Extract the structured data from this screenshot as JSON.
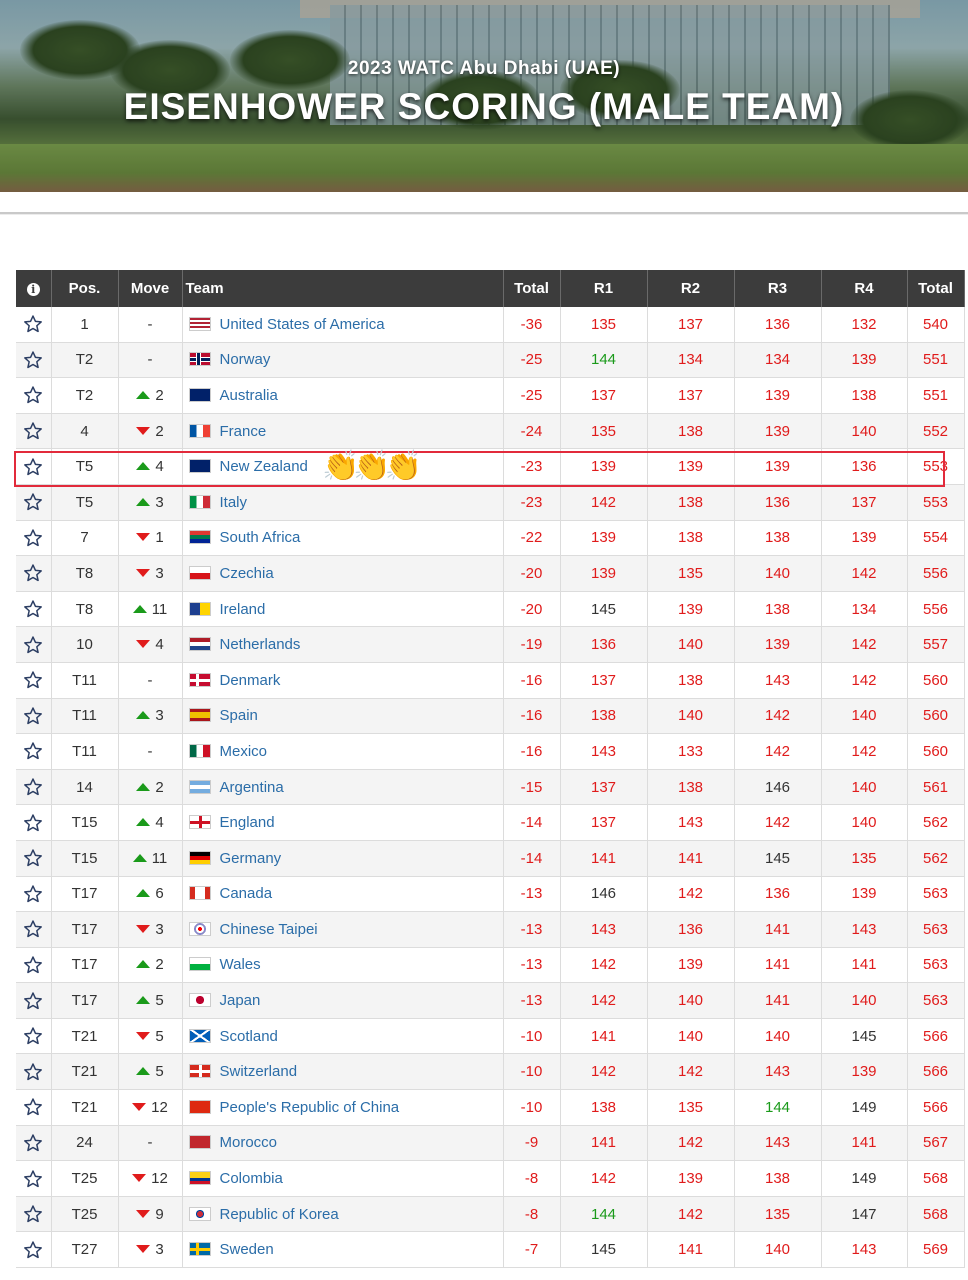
{
  "hero": {
    "subtitle": "2023 WATC Abu Dhabi (UAE)",
    "title": "EISENHOWER SCORING (MALE TEAM)"
  },
  "columns": [
    "Pos.",
    "Move",
    "Team",
    "Total",
    "R1",
    "R2",
    "R3",
    "R4",
    "Total"
  ],
  "colors": {
    "red": "#e01b1b",
    "green": "#1a9a1a",
    "link": "#2b6da8",
    "header": "#3c3c3c",
    "highlight": "#e22a3b"
  },
  "highlight_emoji": "👏👏👏",
  "rows": [
    {
      "pos": "1",
      "dir": "",
      "move": "-",
      "team": "United States of America",
      "flag": "us",
      "total": "-36",
      "r": [
        [
          "135",
          "red"
        ],
        [
          "137",
          "red"
        ],
        [
          "136",
          "red"
        ],
        [
          "132",
          "red"
        ]
      ],
      "sum": "540"
    },
    {
      "pos": "T2",
      "dir": "",
      "move": "-",
      "team": "Norway",
      "flag": "no",
      "total": "-25",
      "r": [
        [
          "144",
          "green"
        ],
        [
          "134",
          "red"
        ],
        [
          "134",
          "red"
        ],
        [
          "139",
          "red"
        ]
      ],
      "sum": "551"
    },
    {
      "pos": "T2",
      "dir": "up",
      "move": "2",
      "team": "Australia",
      "flag": "au",
      "total": "-25",
      "r": [
        [
          "137",
          "red"
        ],
        [
          "137",
          "red"
        ],
        [
          "139",
          "red"
        ],
        [
          "138",
          "red"
        ]
      ],
      "sum": "551"
    },
    {
      "pos": "4",
      "dir": "down",
      "move": "2",
      "team": "France",
      "flag": "fr",
      "total": "-24",
      "r": [
        [
          "135",
          "red"
        ],
        [
          "138",
          "red"
        ],
        [
          "139",
          "red"
        ],
        [
          "140",
          "red"
        ]
      ],
      "sum": "552"
    },
    {
      "pos": "T5",
      "dir": "up",
      "move": "4",
      "team": "New Zealand",
      "flag": "nz",
      "total": "-23",
      "r": [
        [
          "139",
          "red"
        ],
        [
          "139",
          "red"
        ],
        [
          "139",
          "red"
        ],
        [
          "136",
          "red"
        ]
      ],
      "sum": "553"
    },
    {
      "pos": "T5",
      "dir": "up",
      "move": "3",
      "team": "Italy",
      "flag": "it",
      "total": "-23",
      "r": [
        [
          "142",
          "red"
        ],
        [
          "138",
          "red"
        ],
        [
          "136",
          "red"
        ],
        [
          "137",
          "red"
        ]
      ],
      "sum": "553"
    },
    {
      "pos": "7",
      "dir": "down",
      "move": "1",
      "team": "South Africa",
      "flag": "za",
      "total": "-22",
      "r": [
        [
          "139",
          "red"
        ],
        [
          "138",
          "red"
        ],
        [
          "138",
          "red"
        ],
        [
          "139",
          "red"
        ]
      ],
      "sum": "554"
    },
    {
      "pos": "T8",
      "dir": "down",
      "move": "3",
      "team": "Czechia",
      "flag": "cz",
      "total": "-20",
      "r": [
        [
          "139",
          "red"
        ],
        [
          "135",
          "red"
        ],
        [
          "140",
          "red"
        ],
        [
          "142",
          "red"
        ]
      ],
      "sum": "556"
    },
    {
      "pos": "T8",
      "dir": "up",
      "move": "11",
      "team": "Ireland",
      "flag": "ie",
      "total": "-20",
      "r": [
        [
          "145",
          "dark"
        ],
        [
          "139",
          "red"
        ],
        [
          "138",
          "red"
        ],
        [
          "134",
          "red"
        ]
      ],
      "sum": "556"
    },
    {
      "pos": "10",
      "dir": "down",
      "move": "4",
      "team": "Netherlands",
      "flag": "nl",
      "total": "-19",
      "r": [
        [
          "136",
          "red"
        ],
        [
          "140",
          "red"
        ],
        [
          "139",
          "red"
        ],
        [
          "142",
          "red"
        ]
      ],
      "sum": "557"
    },
    {
      "pos": "T11",
      "dir": "",
      "move": "-",
      "team": "Denmark",
      "flag": "dk",
      "total": "-16",
      "r": [
        [
          "137",
          "red"
        ],
        [
          "138",
          "red"
        ],
        [
          "143",
          "red"
        ],
        [
          "142",
          "red"
        ]
      ],
      "sum": "560"
    },
    {
      "pos": "T11",
      "dir": "up",
      "move": "3",
      "team": "Spain",
      "flag": "es",
      "total": "-16",
      "r": [
        [
          "138",
          "red"
        ],
        [
          "140",
          "red"
        ],
        [
          "142",
          "red"
        ],
        [
          "140",
          "red"
        ]
      ],
      "sum": "560"
    },
    {
      "pos": "T11",
      "dir": "",
      "move": "-",
      "team": "Mexico",
      "flag": "mx",
      "total": "-16",
      "r": [
        [
          "143",
          "red"
        ],
        [
          "133",
          "red"
        ],
        [
          "142",
          "red"
        ],
        [
          "142",
          "red"
        ]
      ],
      "sum": "560"
    },
    {
      "pos": "14",
      "dir": "up",
      "move": "2",
      "team": "Argentina",
      "flag": "ar",
      "total": "-15",
      "r": [
        [
          "137",
          "red"
        ],
        [
          "138",
          "red"
        ],
        [
          "146",
          "dark"
        ],
        [
          "140",
          "red"
        ]
      ],
      "sum": "561"
    },
    {
      "pos": "T15",
      "dir": "up",
      "move": "4",
      "team": "England",
      "flag": "en",
      "total": "-14",
      "r": [
        [
          "137",
          "red"
        ],
        [
          "143",
          "red"
        ],
        [
          "142",
          "red"
        ],
        [
          "140",
          "red"
        ]
      ],
      "sum": "562"
    },
    {
      "pos": "T15",
      "dir": "up",
      "move": "11",
      "team": "Germany",
      "flag": "de",
      "total": "-14",
      "r": [
        [
          "141",
          "red"
        ],
        [
          "141",
          "red"
        ],
        [
          "145",
          "dark"
        ],
        [
          "135",
          "red"
        ]
      ],
      "sum": "562"
    },
    {
      "pos": "T17",
      "dir": "up",
      "move": "6",
      "team": "Canada",
      "flag": "ca",
      "total": "-13",
      "r": [
        [
          "146",
          "dark"
        ],
        [
          "142",
          "red"
        ],
        [
          "136",
          "red"
        ],
        [
          "139",
          "red"
        ]
      ],
      "sum": "563"
    },
    {
      "pos": "T17",
      "dir": "down",
      "move": "3",
      "team": "Chinese Taipei",
      "flag": "tpe",
      "total": "-13",
      "r": [
        [
          "143",
          "red"
        ],
        [
          "136",
          "red"
        ],
        [
          "141",
          "red"
        ],
        [
          "143",
          "red"
        ]
      ],
      "sum": "563"
    },
    {
      "pos": "T17",
      "dir": "up",
      "move": "2",
      "team": "Wales",
      "flag": "wa",
      "total": "-13",
      "r": [
        [
          "142",
          "red"
        ],
        [
          "139",
          "red"
        ],
        [
          "141",
          "red"
        ],
        [
          "141",
          "red"
        ]
      ],
      "sum": "563"
    },
    {
      "pos": "T17",
      "dir": "up",
      "move": "5",
      "team": "Japan",
      "flag": "jp",
      "total": "-13",
      "r": [
        [
          "142",
          "red"
        ],
        [
          "140",
          "red"
        ],
        [
          "141",
          "red"
        ],
        [
          "140",
          "red"
        ]
      ],
      "sum": "563"
    },
    {
      "pos": "T21",
      "dir": "down",
      "move": "5",
      "team": "Scotland",
      "flag": "sc",
      "total": "-10",
      "r": [
        [
          "141",
          "red"
        ],
        [
          "140",
          "red"
        ],
        [
          "140",
          "red"
        ],
        [
          "145",
          "dark"
        ]
      ],
      "sum": "566"
    },
    {
      "pos": "T21",
      "dir": "up",
      "move": "5",
      "team": "Switzerland",
      "flag": "ch",
      "total": "-10",
      "r": [
        [
          "142",
          "red"
        ],
        [
          "142",
          "red"
        ],
        [
          "143",
          "red"
        ],
        [
          "139",
          "red"
        ]
      ],
      "sum": "566"
    },
    {
      "pos": "T21",
      "dir": "down",
      "move": "12",
      "team": "People's Republic of China",
      "flag": "cn",
      "total": "-10",
      "r": [
        [
          "138",
          "red"
        ],
        [
          "135",
          "red"
        ],
        [
          "144",
          "green"
        ],
        [
          "149",
          "dark"
        ]
      ],
      "sum": "566"
    },
    {
      "pos": "24",
      "dir": "",
      "move": "-",
      "team": "Morocco",
      "flag": "ma",
      "total": "-9",
      "r": [
        [
          "141",
          "red"
        ],
        [
          "142",
          "red"
        ],
        [
          "143",
          "red"
        ],
        [
          "141",
          "red"
        ]
      ],
      "sum": "567"
    },
    {
      "pos": "T25",
      "dir": "down",
      "move": "12",
      "team": "Colombia",
      "flag": "co",
      "total": "-8",
      "r": [
        [
          "142",
          "red"
        ],
        [
          "139",
          "red"
        ],
        [
          "138",
          "red"
        ],
        [
          "149",
          "dark"
        ]
      ],
      "sum": "568"
    },
    {
      "pos": "T25",
      "dir": "down",
      "move": "9",
      "team": "Republic of Korea",
      "flag": "kr",
      "total": "-8",
      "r": [
        [
          "144",
          "green"
        ],
        [
          "142",
          "red"
        ],
        [
          "135",
          "red"
        ],
        [
          "147",
          "dark"
        ]
      ],
      "sum": "568"
    },
    {
      "pos": "T27",
      "dir": "down",
      "move": "3",
      "team": "Sweden",
      "flag": "se",
      "total": "-7",
      "r": [
        [
          "145",
          "dark"
        ],
        [
          "141",
          "red"
        ],
        [
          "140",
          "red"
        ],
        [
          "143",
          "red"
        ]
      ],
      "sum": "569"
    }
  ]
}
